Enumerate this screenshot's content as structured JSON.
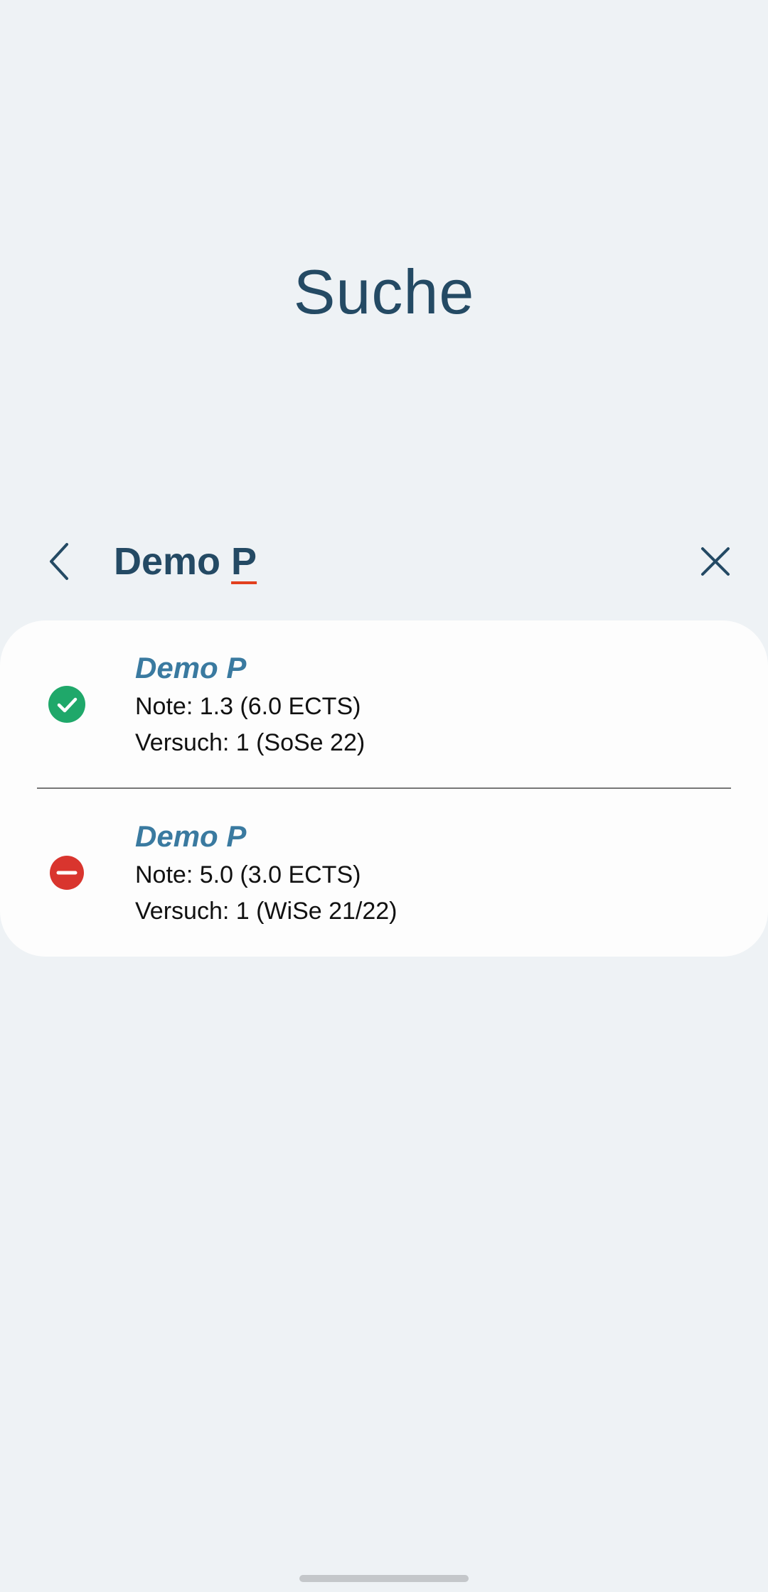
{
  "page": {
    "title": "Suche"
  },
  "search": {
    "query_main": "Demo ",
    "query_underlined": "P",
    "back_icon": "chevron-left-icon",
    "clear_icon": "close-icon"
  },
  "results": [
    {
      "title": "Demo P",
      "note": "Note: 1.3 (6.0 ECTS)",
      "attempt": "Versuch: 1 (SoSe 22)",
      "status": "passed",
      "status_icon": "check-circle-icon",
      "status_color": "#1fa86a"
    },
    {
      "title": "Demo P",
      "note": "Note: 5.0 (3.0 ECTS)",
      "attempt": "Versuch: 1 (WiSe 21/22)",
      "status": "failed",
      "status_icon": "minus-circle-icon",
      "status_color": "#d9352e"
    }
  ],
  "colors": {
    "background": "#eef2f5",
    "title": "#244a64",
    "result_title": "#3a7aa0",
    "spellcheck_underline": "#e2401e"
  }
}
